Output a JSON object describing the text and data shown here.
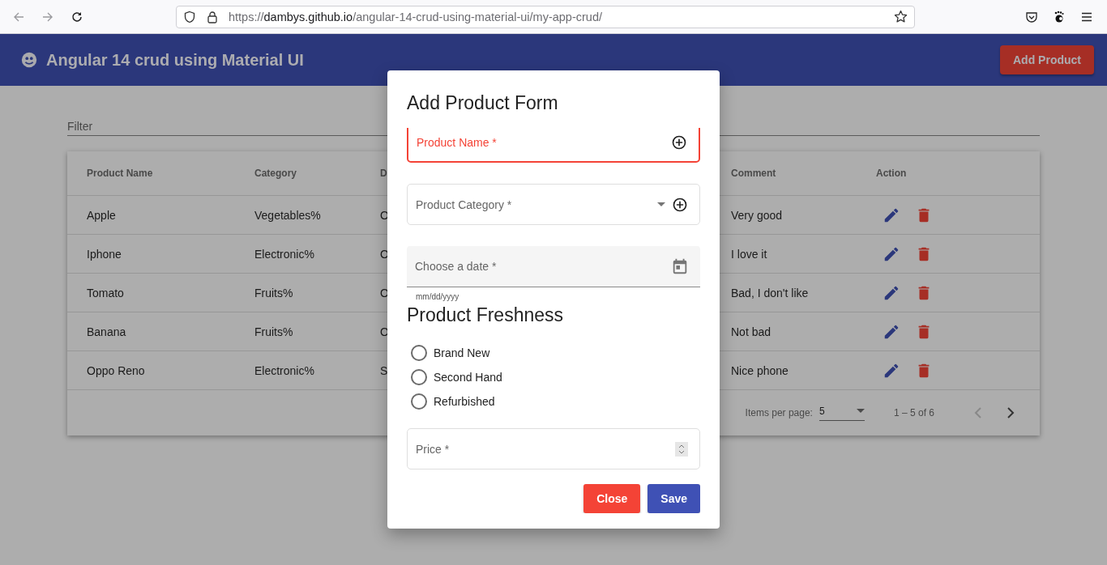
{
  "browser": {
    "url_scheme": "https://",
    "url_host": "dambys.github.io",
    "url_path": "/angular-14-crud-using-material-ui/my-app-crud/"
  },
  "toolbar": {
    "title": "Angular 14 crud using Material UI",
    "button": "Add Product"
  },
  "filter": {
    "placeholder": "Filter"
  },
  "table": {
    "columns": [
      "Product Name",
      "Category",
      "D",
      "Comment",
      "Action"
    ],
    "rows": [
      {
        "cells": [
          "Apple",
          "Vegetables%",
          "O",
          "Very good"
        ]
      },
      {
        "cells": [
          "Iphone",
          "Electronic%",
          "O",
          "I love it"
        ]
      },
      {
        "cells": [
          "Tomato",
          "Fruits%",
          "O",
          "Bad, I don't like"
        ]
      },
      {
        "cells": [
          "Banana",
          "Fruits%",
          "O",
          "Not bad"
        ]
      },
      {
        "cells": [
          "Oppo Reno",
          "Electronic%",
          "S",
          "Nice phone"
        ]
      }
    ]
  },
  "paginator": {
    "label": "Items per page:",
    "page_size": "5",
    "range": "1 – 5 of 6",
    "previous_disabled": true,
    "next_disabled": false
  },
  "dialog": {
    "title": "Add Product Form",
    "fields": [
      {
        "kind": "text",
        "label": "Product Name *",
        "invalid": true
      },
      {
        "kind": "select",
        "label": "Product Category *",
        "invalid": false
      },
      {
        "kind": "date",
        "label": "Choose a date *",
        "invalid": false,
        "hint": "mm/dd/yyyy"
      }
    ],
    "freshness": {
      "title": "Product Freshness",
      "options": [
        {
          "label": "Brand New",
          "selected": false
        },
        {
          "label": "Second Hand",
          "selected": false
        },
        {
          "label": "Refurbished",
          "selected": false
        }
      ]
    },
    "price": {
      "kind": "number",
      "label": "Price *",
      "invalid": false
    },
    "buttons": [
      {
        "kind": "warn",
        "label": "Close"
      },
      {
        "kind": "primary",
        "label": "Save"
      }
    ]
  }
}
